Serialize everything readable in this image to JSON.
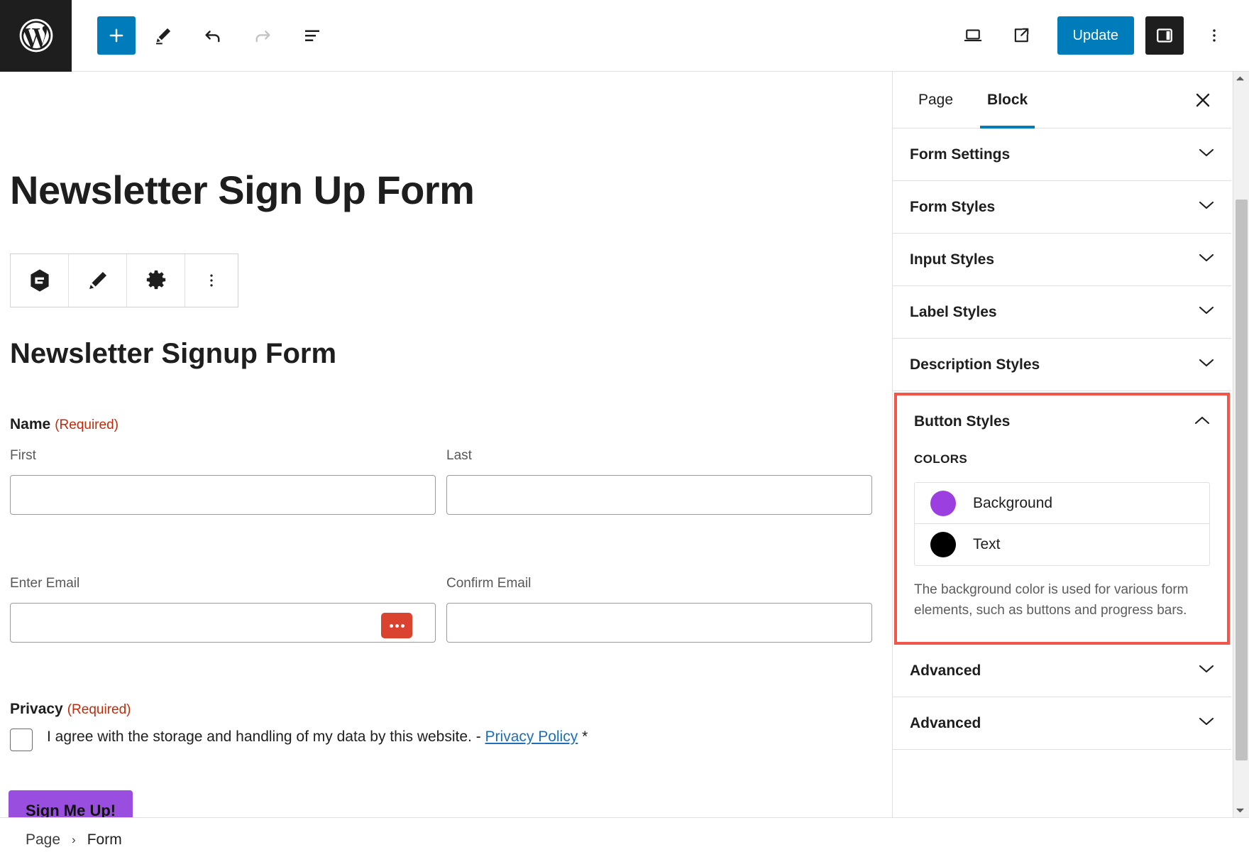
{
  "topbar": {
    "logo_name": "wordpress-logo",
    "add_block_label": "+",
    "update_label": "Update",
    "tools": [
      {
        "name": "add-block-button",
        "label": "Add block"
      },
      {
        "name": "edit-tool-button",
        "label": "Tools"
      },
      {
        "name": "undo-button",
        "label": "Undo"
      },
      {
        "name": "redo-button",
        "label": "Redo"
      },
      {
        "name": "list-view-button",
        "label": "Document Overview"
      }
    ],
    "right_tools": [
      {
        "name": "view-device-button",
        "label": "View"
      },
      {
        "name": "preview-external-button",
        "label": "Preview in new tab"
      }
    ],
    "settings_toggle_label": "Settings",
    "more_menu_label": "Options"
  },
  "canvas": {
    "post_title": "Newsletter Sign Up Form",
    "block_toolbar": [
      {
        "name": "gravity-forms-block-icon",
        "label": "Gravity Forms"
      },
      {
        "name": "edit-pencil-icon",
        "label": "Edit"
      },
      {
        "name": "gear-icon",
        "label": "Form settings"
      },
      {
        "name": "more-options-icon",
        "label": "Options"
      }
    ],
    "form": {
      "heading": "Newsletter Signup Form",
      "name_label": "Name",
      "name_required": "(Required)",
      "first_sublabel": "First",
      "last_sublabel": "Last",
      "first_value": "",
      "last_value": "",
      "email_label": "Enter Email",
      "confirm_email_label": "Confirm Email",
      "email_value": "",
      "confirm_email_value": "",
      "email_more_button": "more-options",
      "privacy_label": "Privacy",
      "privacy_required": "(Required)",
      "privacy_text_before": "I agree with the storage and handling of my data by this website. - ",
      "privacy_link": "Privacy Policy",
      "privacy_text_after": " *",
      "submit_label": "Sign Me Up!",
      "submit_bg": "#9a4ee0",
      "submit_text_color": "#111111"
    }
  },
  "sidebar": {
    "tabs": [
      {
        "label": "Page",
        "active": false
      },
      {
        "label": "Block",
        "active": true
      }
    ],
    "close_label": "Close Settings",
    "panels": [
      {
        "label": "Form Settings",
        "expanded": false
      },
      {
        "label": "Form Styles",
        "expanded": false
      },
      {
        "label": "Input Styles",
        "expanded": false
      },
      {
        "label": "Label Styles",
        "expanded": false
      },
      {
        "label": "Description Styles",
        "expanded": false
      }
    ],
    "button_styles": {
      "label": "Button Styles",
      "expanded": true,
      "highlight_color": "#f2564a",
      "colors_label": "COLORS",
      "colors": [
        {
          "name": "Background",
          "value": "#9b3fe0"
        },
        {
          "name": "Text",
          "value": "#000000"
        }
      ],
      "help_text": "The background color is used for various form elements, such as buttons and progress bars."
    },
    "trailing_panels": [
      {
        "label": "Advanced",
        "expanded": false
      },
      {
        "label": "Advanced",
        "expanded": false
      }
    ]
  },
  "breadcrumb": {
    "items": [
      "Page",
      "Form"
    ],
    "separator": "›"
  }
}
